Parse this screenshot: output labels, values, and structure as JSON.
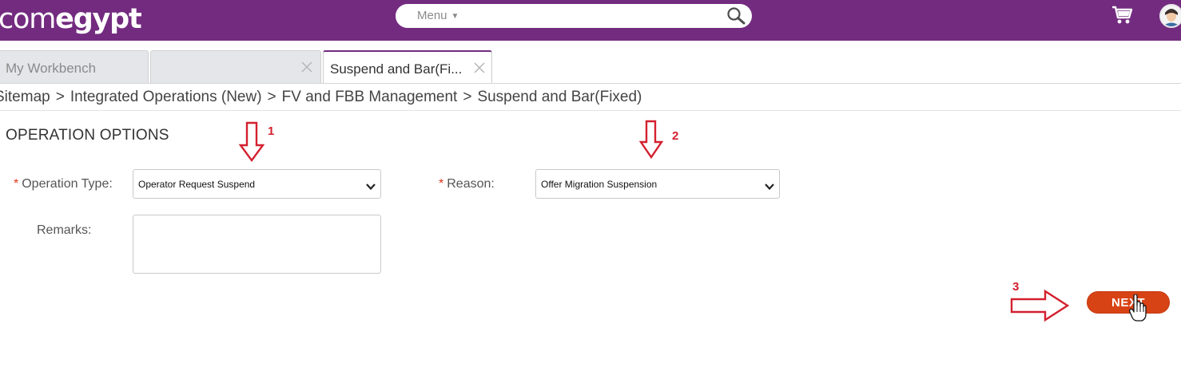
{
  "header": {
    "logo_light": "com",
    "logo_bold": "egypt",
    "menu_label": "Menu",
    "menu_caret": "▼",
    "icons": [
      "search-icon",
      "cart-icon",
      "user-avatar"
    ],
    "brand_color": "#732b80"
  },
  "tabs": [
    {
      "label": "My Workbench",
      "closable": false,
      "active": false
    },
    {
      "label": "",
      "closable": true,
      "active": false
    },
    {
      "label": "Suspend and Bar(Fi...",
      "closable": true,
      "active": true
    }
  ],
  "breadcrumb": {
    "items": [
      "Sitemap",
      "Integrated Operations (New)",
      "FV and FBB Management",
      "Suspend and Bar(Fixed)"
    ],
    "separator": ">"
  },
  "form": {
    "section_title": "OPERATION OPTIONS",
    "required_marker": "*",
    "operation_type": {
      "label": "Operation Type:",
      "value": "Operator Request Suspend",
      "required": true
    },
    "reason": {
      "label": "Reason:",
      "value": "Offer Migration Suspension",
      "required": true
    },
    "remarks": {
      "label": "Remarks:",
      "value": ""
    }
  },
  "annotations": {
    "labels": [
      "1",
      "2",
      "3"
    ],
    "color": "#d3202f"
  },
  "next_button": {
    "label": "NEXT",
    "color": "#d84315"
  }
}
